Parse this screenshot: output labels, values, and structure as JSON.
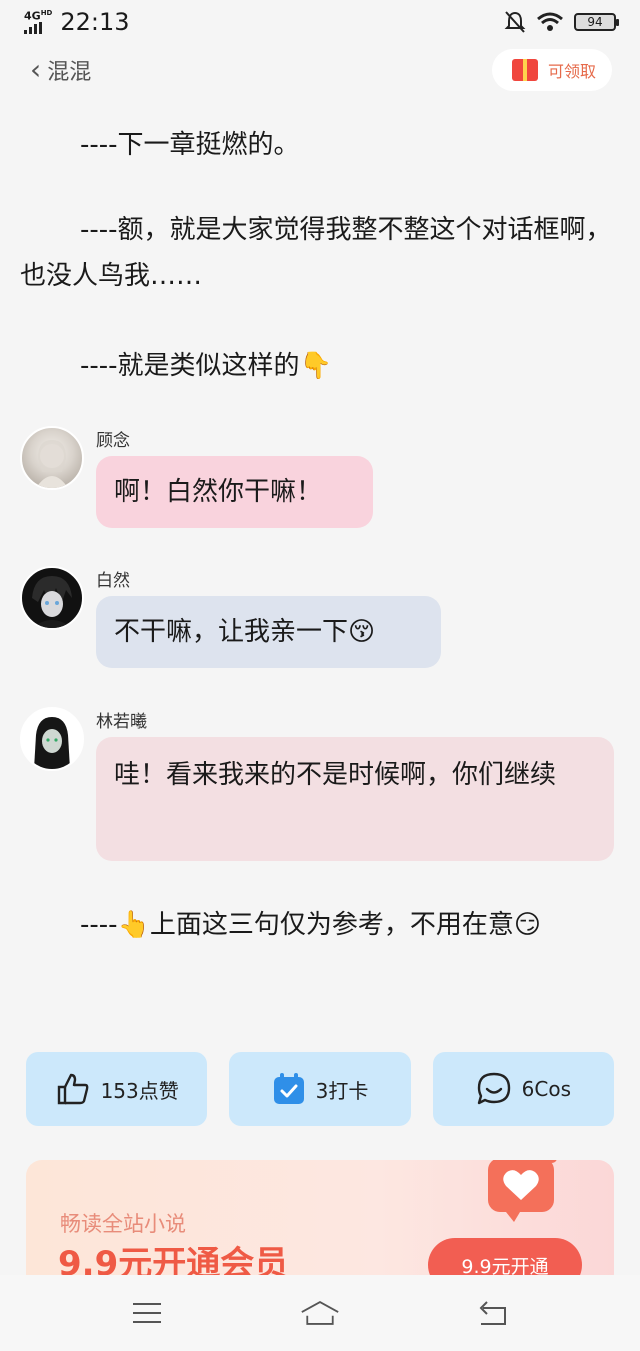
{
  "status_bar": {
    "network": "4G",
    "network_hd": "HD",
    "time": "22:13",
    "battery": "94"
  },
  "nav": {
    "back_label": "混混",
    "claim_label": "可领取"
  },
  "paragraphs": [
    "----下一章挺燃的。",
    "----额，就是大家觉得我整不整这个对话框啊，也没人鸟我……",
    "----就是类似这样的👇"
  ],
  "chats": [
    {
      "name": "顾念",
      "message": "啊！白然你干嘛！",
      "bubble_color": "#f9d3dd"
    },
    {
      "name": "白然",
      "message": "不干嘛，让我亲一下😚",
      "bubble_color": "#dde3ee"
    },
    {
      "name": "林若曦",
      "message": "哇！看来我来的不是时候啊，你们继续",
      "bubble_color": "#f3dfe2"
    }
  ],
  "closing_paragraph": "----👆上面这三句仅为参考，不用在意😏",
  "actions": [
    {
      "icon": "thumbs-up-icon",
      "label": "153点赞"
    },
    {
      "icon": "calendar-check-icon",
      "label": "3打卡"
    },
    {
      "icon": "chat-bubble-icon",
      "label": "6Cos"
    }
  ],
  "promo": {
    "subtitle": "畅读全站小说",
    "title": "9.9元开通会员",
    "button_label": "9.9元开通"
  },
  "colors": {
    "accent_blue": "#cce8fb",
    "promo_red": "#ef5a45",
    "claim_orange": "#e66a4a"
  }
}
